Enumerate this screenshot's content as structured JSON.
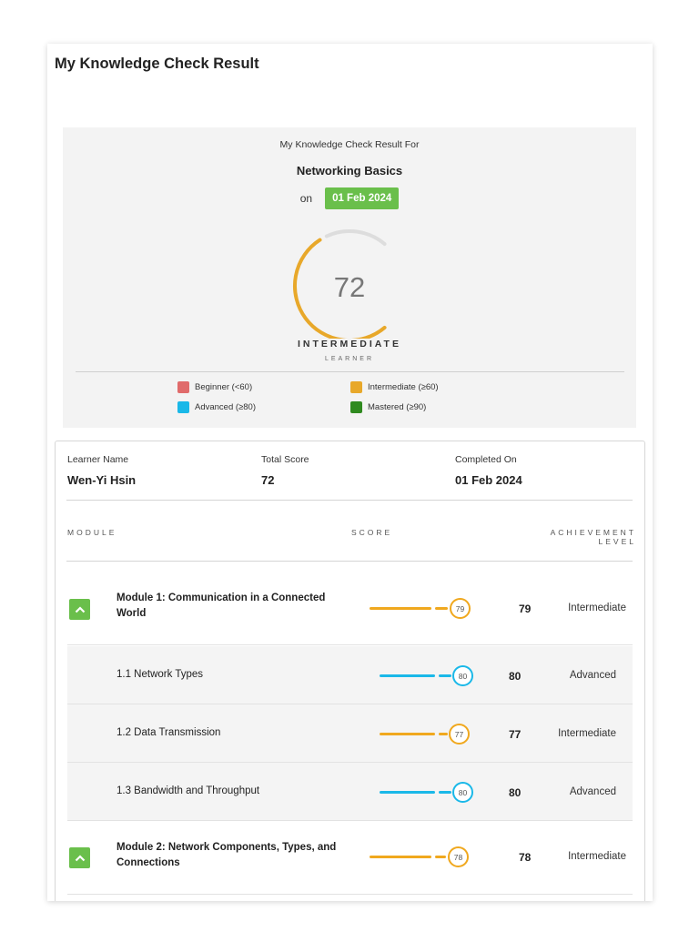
{
  "header": {
    "title": "My Knowledge Check Result"
  },
  "summary": {
    "for_label": "My Knowledge Check Result For",
    "course": "Networking Basics",
    "on_label": "on",
    "date": "01 Feb 2024",
    "score": "72",
    "score_fraction": 0.72,
    "level": "INTERMEDIATE",
    "level_sub": "LEARNER",
    "legend": [
      {
        "label": "Beginner (<60)",
        "color": "#e06b6b"
      },
      {
        "label": "Intermediate (≥60)",
        "color": "#e8a82a"
      },
      {
        "label": "Advanced (≥80)",
        "color": "#1ab8e8"
      },
      {
        "label": "Mastered (≥90)",
        "color": "#2f8a1f"
      }
    ]
  },
  "details": {
    "learner_label": "Learner Name",
    "learner_value": "Wen-Yi Hsin",
    "total_label": "Total Score",
    "total_value": "72",
    "completed_label": "Completed On",
    "completed_value": "01 Feb 2024",
    "col_module": "MODULE",
    "col_score": "SCORE",
    "col_achievement_1": "ACHIEVEMENT",
    "col_achievement_2": "LEVEL"
  },
  "rows": [
    {
      "title": "Module 1: Communication in a Connected World",
      "score": "79",
      "level": "Intermediate",
      "color": "#f0a81e"
    },
    {
      "title": "1.1 Network Types",
      "score": "80",
      "level": "Advanced",
      "color": "#1ab8e8"
    },
    {
      "title": "1.2 Data Transmission",
      "score": "77",
      "level": "Intermediate",
      "color": "#f0a81e"
    },
    {
      "title": "1.3 Bandwidth and Throughput",
      "score": "80",
      "level": "Advanced",
      "color": "#1ab8e8"
    },
    {
      "title": "Module 2: Network Components, Types, and Connections",
      "score": "78",
      "level": "Intermediate",
      "color": "#f0a81e"
    }
  ],
  "colors": {
    "accent_green": "#6abf4b",
    "gauge_track": "#dddddd",
    "gauge_fill": "#e8a82a"
  },
  "icons": {
    "expand": "chevron-up-icon"
  }
}
